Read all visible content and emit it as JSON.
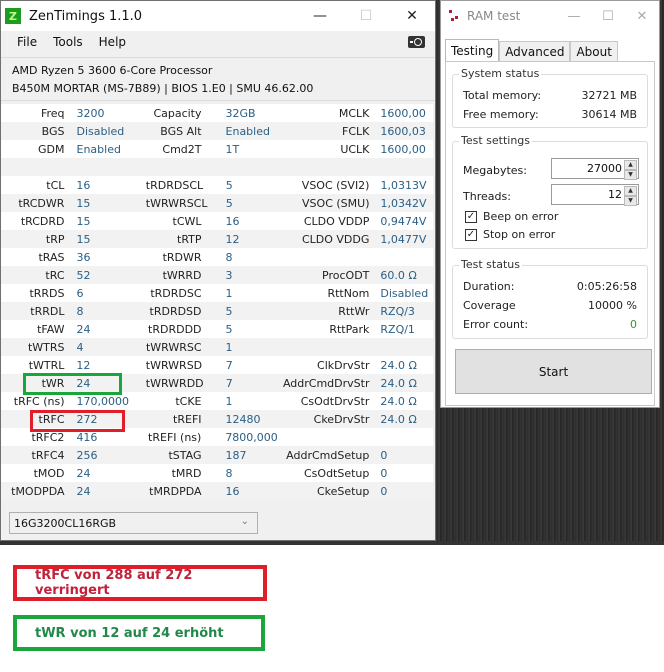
{
  "zentimings": {
    "title": "ZenTimings 1.1.0",
    "menu": [
      "File",
      "Tools",
      "Help"
    ],
    "cpu": "AMD Ryzen 5 3600 6-Core Processor",
    "board": "B450M MORTAR (MS-7B89) | BIOS 1.E0 | SMU 46.62.00",
    "rows": [
      [
        "Freq",
        "3200",
        "Capacity",
        "32GB",
        "MCLK",
        "1600,00"
      ],
      [
        "BGS",
        "Disabled",
        "BGS Alt",
        "Enabled",
        "FCLK",
        "1600,03"
      ],
      [
        "GDM",
        "Enabled",
        "Cmd2T",
        "1T",
        "UCLK",
        "1600,00"
      ],
      [
        "",
        "",
        "",
        "",
        "",
        ""
      ],
      [
        "tCL",
        "16",
        "tRDRDSCL",
        "5",
        "VSOC (SVI2)",
        "1,0313V"
      ],
      [
        "tRCDWR",
        "15",
        "tWRWRSCL",
        "5",
        "VSOC (SMU)",
        "1,0342V"
      ],
      [
        "tRCDRD",
        "15",
        "tCWL",
        "16",
        "CLDO VDDP",
        "0,9474V"
      ],
      [
        "tRP",
        "15",
        "tRTP",
        "12",
        "CLDO VDDG",
        "1,0477V"
      ],
      [
        "tRAS",
        "36",
        "tRDWR",
        "8",
        "",
        ""
      ],
      [
        "tRC",
        "52",
        "tWRRD",
        "3",
        "ProcODT",
        "60.0 Ω"
      ],
      [
        "tRRDS",
        "6",
        "tRDRDSC",
        "1",
        "RttNom",
        "Disabled"
      ],
      [
        "tRRDL",
        "8",
        "tRDRDSD",
        "5",
        "RttWr",
        "RZQ/3"
      ],
      [
        "tFAW",
        "24",
        "tRDRDDD",
        "5",
        "RttPark",
        "RZQ/1"
      ],
      [
        "tWTRS",
        "4",
        "tWRWRSC",
        "1",
        "",
        ""
      ],
      [
        "tWTRL",
        "12",
        "tWRWRSD",
        "7",
        "ClkDrvStr",
        "24.0 Ω"
      ],
      [
        "tWR",
        "24",
        "tWRWRDD",
        "7",
        "AddrCmdDrvStr",
        "24.0 Ω"
      ],
      [
        "tRFC (ns)",
        "170,0000",
        "tCKE",
        "1",
        "CsOdtDrvStr",
        "24.0 Ω"
      ],
      [
        "tRFC",
        "272",
        "tREFI",
        "12480",
        "CkeDrvStr",
        "24.0 Ω"
      ],
      [
        "tRFC2",
        "416",
        "tREFI (ns)",
        "7800,000",
        "",
        ""
      ],
      [
        "tRFC4",
        "256",
        "tSTAG",
        "187",
        "AddrCmdSetup",
        "0"
      ],
      [
        "tMOD",
        "24",
        "tMRD",
        "8",
        "CsOdtSetup",
        "0"
      ],
      [
        "tMODPDA",
        "24",
        "tMRDPDA",
        "16",
        "CkeSetup",
        "0"
      ]
    ],
    "profile": "16G3200CL16RGB"
  },
  "ramtest": {
    "title": "RAM test",
    "tabs": [
      "Testing",
      "Advanced",
      "About"
    ],
    "system_status": {
      "title": "System status",
      "total_label": "Total memory:",
      "total_value": "32721 MB",
      "free_label": "Free memory:",
      "free_value": "30614 MB"
    },
    "test_settings": {
      "title": "Test settings",
      "megabytes_label": "Megabytes:",
      "megabytes_value": "27000",
      "threads_label": "Threads:",
      "threads_value": "12",
      "beep_label": "Beep on error",
      "beep_checked": true,
      "stop_label": "Stop on error",
      "stop_checked": true
    },
    "test_status": {
      "title": "Test status",
      "duration_label": "Duration:",
      "duration_value": "0:05:26:58",
      "coverage_label": "Coverage",
      "coverage_value": "10000 %",
      "errors_label": "Error count:",
      "errors_value": "0",
      "errors_color": "#2e9a2e"
    },
    "start_label": "Start"
  },
  "notes": {
    "red": "tRFC von 288 auf 272 verringert",
    "green": "tWR von 12 auf 24 erhöht"
  },
  "colors": {
    "highlight_red": "#e01e2a",
    "highlight_green": "#1aa63a",
    "value_blue": "#2a5f86"
  }
}
